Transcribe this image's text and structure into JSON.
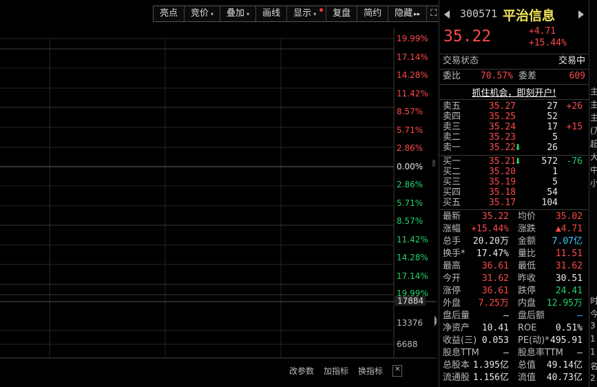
{
  "toolbar": {
    "items": [
      "亮点",
      "竞价",
      "叠加",
      "画线",
      "显示",
      "复盘",
      "简约",
      "隐藏"
    ],
    "caret": "▾",
    "hide_arrow": "▸▸",
    "fullscreen_icon": "⛶"
  },
  "chart": {
    "pct_labels": [
      {
        "text": "19.99%",
        "color": "red"
      },
      {
        "text": "17.14%",
        "color": "red"
      },
      {
        "text": "14.28%",
        "color": "red"
      },
      {
        "text": "11.42%",
        "color": "red"
      },
      {
        "text": "8.57%",
        "color": "red"
      },
      {
        "text": "5.71%",
        "color": "red"
      },
      {
        "text": "2.86%",
        "color": "red"
      },
      {
        "text": "0.00%",
        "color": "white"
      },
      {
        "text": "2.86%",
        "color": "green"
      },
      {
        "text": "5.71%",
        "color": "green"
      },
      {
        "text": "8.57%",
        "color": "green"
      },
      {
        "text": "11.42%",
        "color": "green"
      },
      {
        "text": "14.28%",
        "color": "green"
      },
      {
        "text": "17.14%",
        "color": "green"
      },
      {
        "text": "19.99%",
        "color": "green"
      }
    ],
    "vol_labels": [
      "17884",
      "13376",
      "6688"
    ],
    "bottom_buttons": [
      "改参数",
      "加指标",
      "换指标"
    ],
    "close_icon": "✕"
  },
  "quote": {
    "code": "300571",
    "name": "平治信息",
    "price": "35.22",
    "change": "+4.71",
    "change_pct": "+15.44%",
    "trade_status_label": "交易状态",
    "trade_status_value": "交易中",
    "ratio_label": "委比",
    "ratio_value": "70.57%",
    "diff_label": "委差",
    "diff_value": "609",
    "promo": "抓住机会，即刻开户!",
    "asks": [
      {
        "label": "卖五",
        "price": "35.27",
        "vol": "27",
        "chg": "+26"
      },
      {
        "label": "卖四",
        "price": "35.25",
        "vol": "52",
        "chg": ""
      },
      {
        "label": "卖三",
        "price": "35.24",
        "vol": "17",
        "chg": "+15"
      },
      {
        "label": "卖二",
        "price": "35.23",
        "vol": "5",
        "chg": ""
      },
      {
        "label": "卖一",
        "price": "35.22",
        "vol": "26",
        "chg": "",
        "arrow": "⬇"
      }
    ],
    "bids": [
      {
        "label": "买一",
        "price": "35.21",
        "vol": "572",
        "chg": "-76",
        "arrow": "⬇"
      },
      {
        "label": "买二",
        "price": "35.20",
        "vol": "1",
        "chg": ""
      },
      {
        "label": "买三",
        "price": "35.19",
        "vol": "5",
        "chg": ""
      },
      {
        "label": "买四",
        "price": "35.18",
        "vol": "54",
        "chg": ""
      },
      {
        "label": "买五",
        "price": "35.17",
        "vol": "104",
        "chg": ""
      }
    ],
    "stats": [
      {
        "l1": "最新",
        "v1": "35.22",
        "c1": "red",
        "l2": "均价",
        "v2": "35.02",
        "c2": "red"
      },
      {
        "l1": "涨幅",
        "v1": "+15.44%",
        "c1": "red",
        "l2": "涨跌",
        "v2": "▲4.71",
        "c2": "red"
      },
      {
        "l1": "总手",
        "v1": "20.20万",
        "c1": "white",
        "l2": "金额",
        "v2": "7.07亿",
        "c2": "cyan"
      },
      {
        "l1": "换手*",
        "v1": "17.47%",
        "c1": "white",
        "l2": "量比",
        "v2": "11.51",
        "c2": "red"
      },
      {
        "l1": "最高",
        "v1": "36.61",
        "c1": "red",
        "l2": "最低",
        "v2": "31.62",
        "c2": "red"
      },
      {
        "l1": "今开",
        "v1": "31.62",
        "c1": "red",
        "l2": "昨收",
        "v2": "30.51",
        "c2": "white"
      },
      {
        "l1": "涨停",
        "v1": "36.61",
        "c1": "red",
        "l2": "跌停",
        "v2": "24.41",
        "c2": "green"
      },
      {
        "l1": "外盘",
        "v1": "7.25万",
        "c1": "red",
        "l2": "内盘",
        "v2": "12.95万",
        "c2": "green"
      },
      {
        "l1": "盘后量",
        "v1": "—",
        "c1": "white",
        "l2": "盘后额",
        "v2": "—",
        "c2": "cyan"
      },
      {
        "l1": "净资产",
        "v1": "10.41",
        "c1": "white",
        "l2": "ROE",
        "v2": "0.51%",
        "c2": "white"
      },
      {
        "l1": "收益(三)",
        "v1": "0.053",
        "c1": "white",
        "l2": "PE(动)*",
        "v2": "495.91",
        "c2": "white"
      },
      {
        "l1": "股息TTM",
        "v1": "—",
        "c1": "white",
        "l2": "股息率TTM",
        "v2": "—",
        "c2": "white"
      },
      {
        "l1": "总股本",
        "v1": "1.395亿",
        "c1": "white",
        "l2": "总值",
        "v2": "49.14亿",
        "c2": "white"
      },
      {
        "l1": "流通股",
        "v1": "1.156亿",
        "c1": "white",
        "l2": "流值",
        "v2": "40.73亿",
        "c2": "white"
      }
    ]
  },
  "edge": {
    "chars": [
      "主",
      "主",
      "主",
      "(万",
      "超",
      "大",
      "中",
      "小",
      "",
      "",
      "",
      "",
      "",
      "",
      "",
      "",
      "时",
      "今",
      "3",
      "1",
      "1",
      "名",
      "2"
    ]
  }
}
